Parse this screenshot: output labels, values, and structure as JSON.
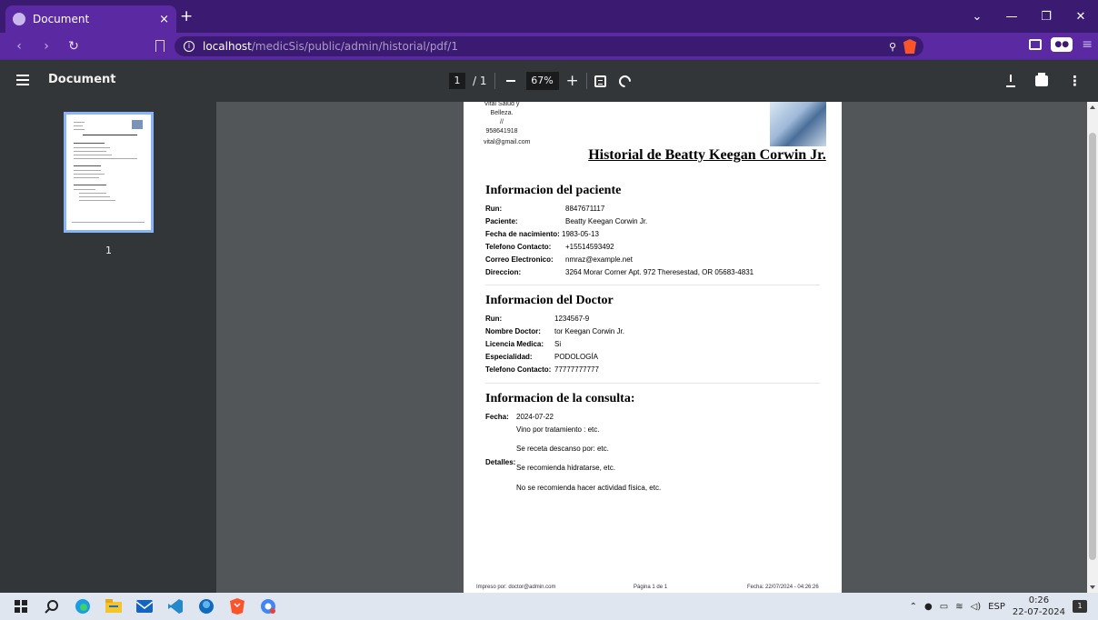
{
  "browser": {
    "tab_title": "Document",
    "tab_close": "×",
    "new_tab": "+",
    "url_host": "localhost",
    "url_path": "/medicSis/public/admin/historial/pdf/1"
  },
  "pdf_toolbar": {
    "title": "Document",
    "page_current": "1",
    "page_total": "/ 1",
    "zoom": "67%"
  },
  "thumbnail": {
    "page_number": "1"
  },
  "document": {
    "clinic_name": "Vital Salud y Belleza.",
    "clinic_sep": "//",
    "clinic_phone": "958641918",
    "clinic_email": "vital@gmail.com",
    "heading": "Historial de Beatty Keegan Corwin Jr.",
    "patient_section": {
      "title": "Informacion del paciente",
      "rows": [
        {
          "label": "Run:",
          "value": "8847671117"
        },
        {
          "label": "Paciente:",
          "value": "Beatty Keegan Corwin Jr."
        },
        {
          "label": "Fecha de nacimiento:",
          "value": "1983-05-13"
        },
        {
          "label": "Telefono Contacto:",
          "value": "+15514593492"
        },
        {
          "label": "Correo Electronico:",
          "value": "nmraz@example.net"
        },
        {
          "label": "Direccion:",
          "value": "3264 Morar Corner Apt. 972 Theresestad, OR 05683-4831"
        }
      ]
    },
    "doctor_section": {
      "title": "Informacion del Doctor",
      "rows": [
        {
          "label": "Run:",
          "value": "1234567-9"
        },
        {
          "label": "Nombre Doctor:",
          "value": "tor Keegan Corwin Jr."
        },
        {
          "label": "Licencia Medica:",
          "value": "Si"
        },
        {
          "label": "Especialidad:",
          "value": "PODOLOGÍA"
        },
        {
          "label": "Telefono Contacto:",
          "value": "77777777777"
        }
      ]
    },
    "consulta_section": {
      "title": "Informacion de la consulta:",
      "fecha_label": "Fecha:",
      "fecha_value": "2024-07-22",
      "detalles_label": "Detalles:",
      "lines": [
        "Vino por tratamiento : etc.",
        "Se receta descanso por: etc.",
        "Se recomienda hidratarse, etc.",
        "No se recomienda hacer actividad física, etc."
      ]
    },
    "footer": {
      "printed_by": "Impreso por: doctor@admin.com",
      "page": "Página 1 de 1",
      "date": "Fecha: 22/07/2024 - 04:26:26"
    }
  },
  "taskbar": {
    "language": "ESP",
    "time": "0:26",
    "date": "22-07-2024",
    "notifications": "1"
  }
}
